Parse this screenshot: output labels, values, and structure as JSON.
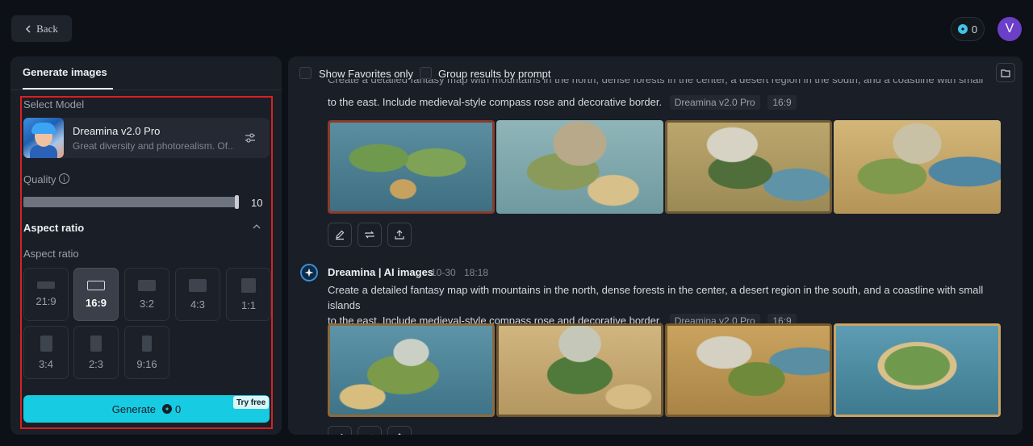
{
  "topbar": {
    "back_label": "Back",
    "credits": "0",
    "avatar_letter": "V"
  },
  "left_panel": {
    "tab": "Generate images",
    "select_model_label": "Select Model",
    "model": {
      "name": "Dreamina v2.0 Pro",
      "description": "Great diversity and photorealism. Of..."
    },
    "quality_label": "Quality",
    "quality_value": "10",
    "quality_fraction": 1.0,
    "aspect_section_title": "Aspect ratio",
    "aspect_label": "Aspect ratio",
    "ratios": [
      {
        "label": "21:9",
        "selected": false
      },
      {
        "label": "16:9",
        "selected": true
      },
      {
        "label": "3:2",
        "selected": false
      },
      {
        "label": "4:3",
        "selected": false
      },
      {
        "label": "1:1",
        "selected": false
      },
      {
        "label": "3:4",
        "selected": false
      },
      {
        "label": "2:3",
        "selected": false
      },
      {
        "label": "9:16",
        "selected": false
      }
    ],
    "generate_label": "Generate",
    "generate_cost": "0",
    "try_free": "Try free"
  },
  "right_panel": {
    "show_favorites": "Show Favorites only",
    "group_results": "Group results by prompt",
    "results": [
      {
        "prompt_partial_top": "Create a detailed fantasy map with mountains in the north, dense forests in the center, a desert region in the south, and a coastline with small islands",
        "prompt_line2": "to the east. Include medieval-style compass rose and decorative border.",
        "model_tag": "Dreamina v2.0 Pro",
        "ratio_tag": "16:9"
      },
      {
        "author": "Dreamina | AI images",
        "date": "10-30",
        "time": "18:18",
        "prompt_line1": "Create a detailed fantasy map with mountains in the north, dense forests in the center, a desert region in the south, and a coastline with small islands",
        "prompt_line2": "to the east. Include medieval-style compass rose and decorative border.",
        "model_tag": "Dreamina v2.0 Pro",
        "ratio_tag": "16:9"
      }
    ]
  },
  "colors": {
    "accent": "#17cbe3",
    "highlight_border": "#d72124",
    "avatar": "#6c3fc8"
  }
}
